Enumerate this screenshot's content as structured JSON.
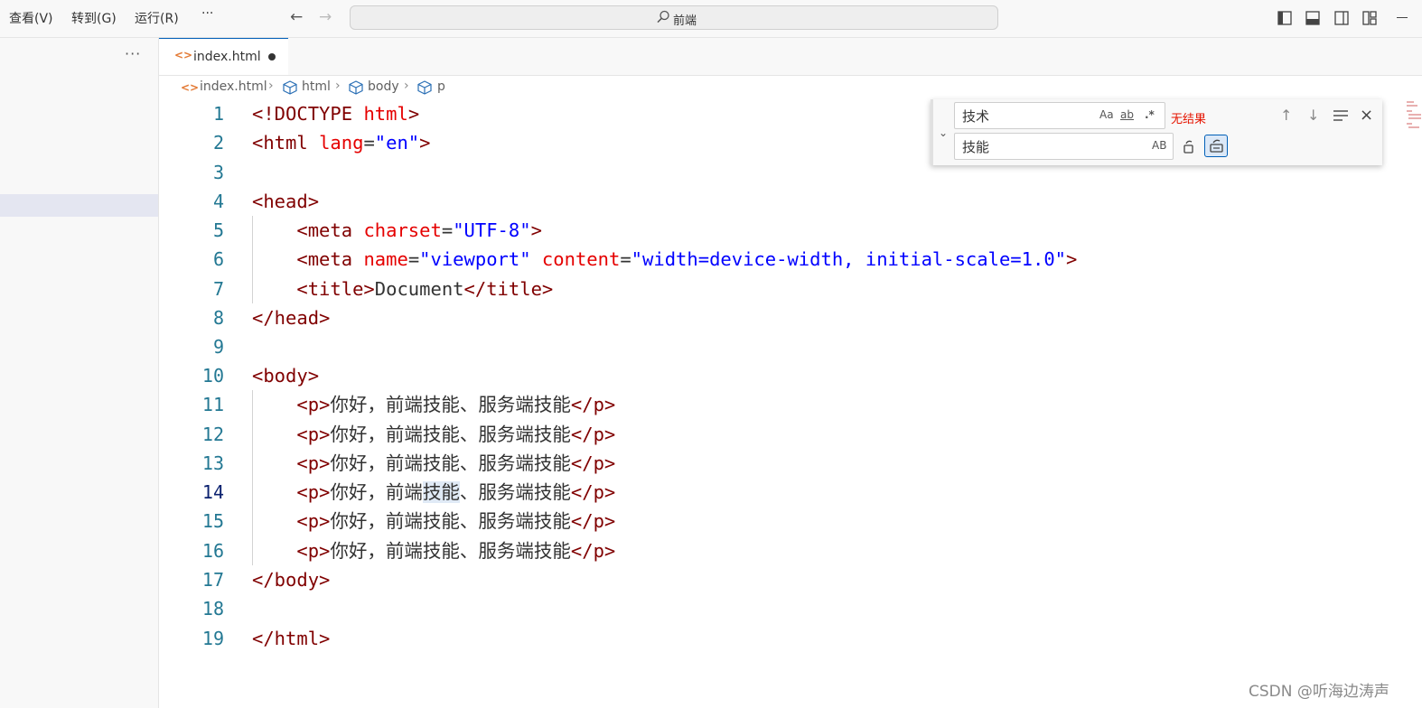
{
  "menu": {
    "items": [
      "查看(V)",
      "转到(G)",
      "运行(R)",
      "···"
    ]
  },
  "nav": {
    "back_icon": "arrow-left-icon",
    "forward_icon": "arrow-right-icon"
  },
  "command_center": {
    "text": "前端",
    "icon": "search-icon"
  },
  "layout_icons": [
    "toggle-primary-sidebar-icon",
    "toggle-panel-icon",
    "toggle-secondary-sidebar-icon",
    "customize-layout-icon"
  ],
  "sidebar": {
    "more": "···"
  },
  "tab": {
    "name": "index.html",
    "icon": "html-file-icon",
    "dirty": true
  },
  "breadcrumbs": [
    "index.html",
    "html",
    "body",
    "p"
  ],
  "find_widget": {
    "find_value": "技术",
    "replace_value": "技能",
    "match_case": "Aa",
    "whole_word": "ab",
    "regex": ".*",
    "preserve_case": "AB",
    "no_results": "无结果"
  },
  "code": {
    "active_line": 14,
    "line_numbers": [
      "1",
      "2",
      "3",
      "4",
      "5",
      "6",
      "7",
      "8",
      "9",
      "10",
      "11",
      "12",
      "13",
      "14",
      "15",
      "16",
      "17",
      "18",
      "19"
    ],
    "line1": {
      "open": "<!DOCTYPE",
      "kw": "html",
      "close": ">"
    },
    "line2": {
      "tag": "<html",
      "attr": "lang",
      "eq": "=",
      "val": "\"en\"",
      "close": ">"
    },
    "line4": "<head>",
    "line5": {
      "tag": "<meta",
      "attr": "charset",
      "eq": "=",
      "val": "\"UTF-8\"",
      "close": ">"
    },
    "line6": {
      "tag": "<meta",
      "attr1": "name",
      "eq1": "=",
      "val1": "\"viewport\"",
      "attr2": "content",
      "eq2": "=",
      "val2": "\"width=device-width, initial-scale=1.0\"",
      "close": ">"
    },
    "line7": {
      "open": "<title>",
      "text": "Document",
      "close": "</title>"
    },
    "line8": "</head>",
    "line10": "<body>",
    "p_open": "<p>",
    "p_close": "</p>",
    "p_text": "你好，前端技能、服务端技能",
    "p14_pre": "你好，前端",
    "p14_hl": "技能",
    "p14_post": "、服务端技能",
    "line17": "</body>",
    "line19": "</html>"
  },
  "watermark": "CSDN @听海边涛声"
}
